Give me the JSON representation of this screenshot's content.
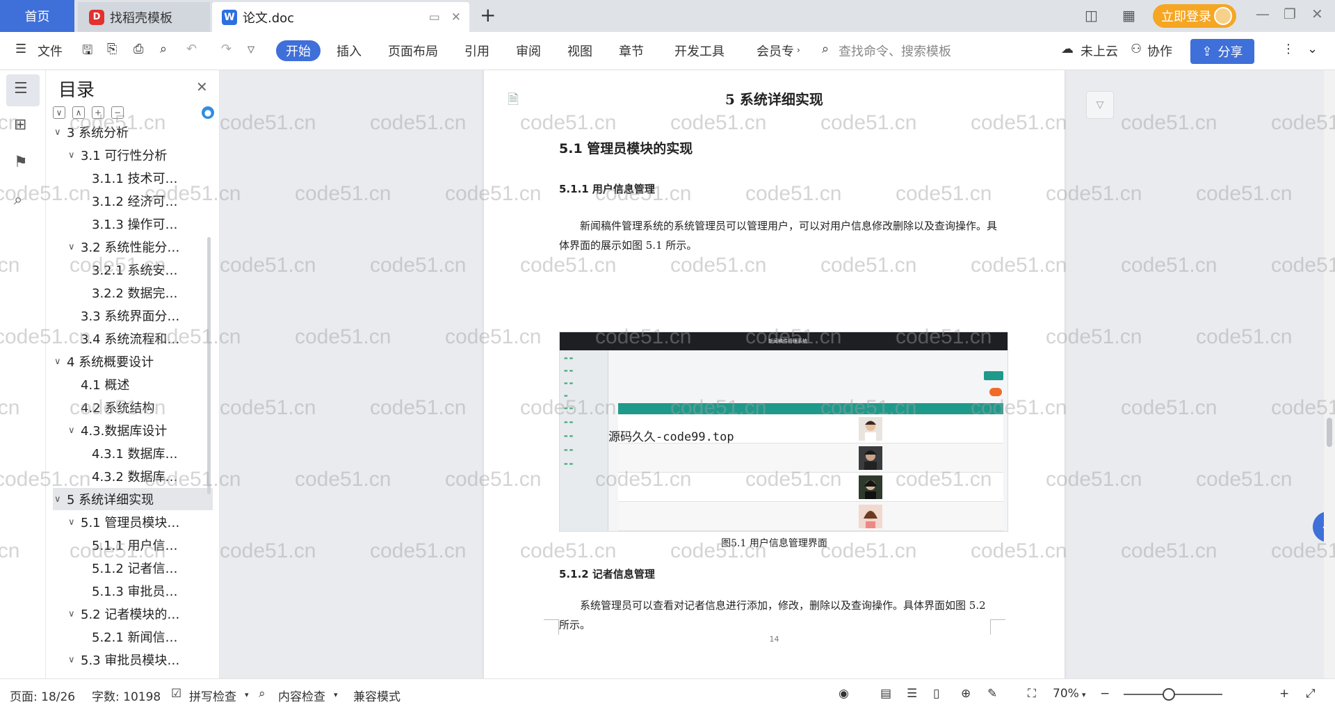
{
  "titlebar": {
    "home_tab": "首页",
    "template_tab": "找稻壳模板",
    "doc_tab": "论文.doc",
    "login_label": "立即登录"
  },
  "toolbar": {
    "file": "文件",
    "start": "开始",
    "insert": "插入",
    "layout": "页面布局",
    "reference": "引用",
    "review": "审阅",
    "view": "视图",
    "chapter": "章节",
    "dev_tools": "开发工具",
    "member": "会员专",
    "search_placeholder": "查找命令、搜索模板",
    "cloud": "未上云",
    "collab": "协作",
    "share": "分享"
  },
  "toc": {
    "title": "目录",
    "items": [
      {
        "label": "3 系统分析",
        "level": 1,
        "expanded": true
      },
      {
        "label": "3.1 可行性分析",
        "level": 2,
        "expanded": true
      },
      {
        "label": "3.1.1 技术可…",
        "level": 3
      },
      {
        "label": "3.1.2 经济可…",
        "level": 3
      },
      {
        "label": "3.1.3 操作可…",
        "level": 3
      },
      {
        "label": "3.2 系统性能分…",
        "level": 2,
        "expanded": true
      },
      {
        "label": "3.2.1  系统安…",
        "level": 3
      },
      {
        "label": "3.2.2  数据完…",
        "level": 3
      },
      {
        "label": "3.3 系统界面分…",
        "level": 2
      },
      {
        "label": "3.4 系统流程和…",
        "level": 2
      },
      {
        "label": "4 系统概要设计",
        "level": 1,
        "expanded": true
      },
      {
        "label": "4.1 概述",
        "level": 2
      },
      {
        "label": "4.2 系统结构",
        "level": 2
      },
      {
        "label": "4.3.数据库设计",
        "level": 2,
        "expanded": true
      },
      {
        "label": "4.3.1 数据库…",
        "level": 3
      },
      {
        "label": "4.3.2 数据库…",
        "level": 3
      },
      {
        "label": "5 系统详细实现",
        "level": 1,
        "expanded": true,
        "selected": true
      },
      {
        "label": "5.1  管理员模块…",
        "level": 2,
        "expanded": true
      },
      {
        "label": "5.1.1  用户信…",
        "level": 3
      },
      {
        "label": "5.1.2  记者信…",
        "level": 3
      },
      {
        "label": "5.1.3  审批员…",
        "level": 3
      },
      {
        "label": "5.2  记者模块的…",
        "level": 2,
        "expanded": true
      },
      {
        "label": "5.2.1  新闻信…",
        "level": 3
      },
      {
        "label": "5.3  审批员模块…",
        "level": 2,
        "expanded": true
      }
    ]
  },
  "page": {
    "chapter_title": "5 系统详细实现",
    "section_title": "5.1  管理员模块的实现",
    "sub1_title": "5.1.1  用户信息管理",
    "para1": "新闻稿件管理系统的系统管理员可以管理用户，可以对用户信息修改删除以及查询操作。具体界面的展示如图 5.1 所示。",
    "figure_caption": "图5.1  用户信息管理界面",
    "figure_header": "新闻稿件管理系统",
    "figure_overlay": "源码久久-code99.top",
    "sub2_title": "5.1.2  记者信息管理",
    "para2": "系统管理员可以查看对记者信息进行添加，修改，删除以及查询操作。具体界面如图 5.2 所示。",
    "page_number": "14"
  },
  "watermark": "code51.cn",
  "statusbar": {
    "page": "页面: 18/26",
    "words": "字数: 10198",
    "spell": "拼写检查",
    "content_check": "内容检查",
    "compat": "兼容模式",
    "zoom": "70%"
  }
}
